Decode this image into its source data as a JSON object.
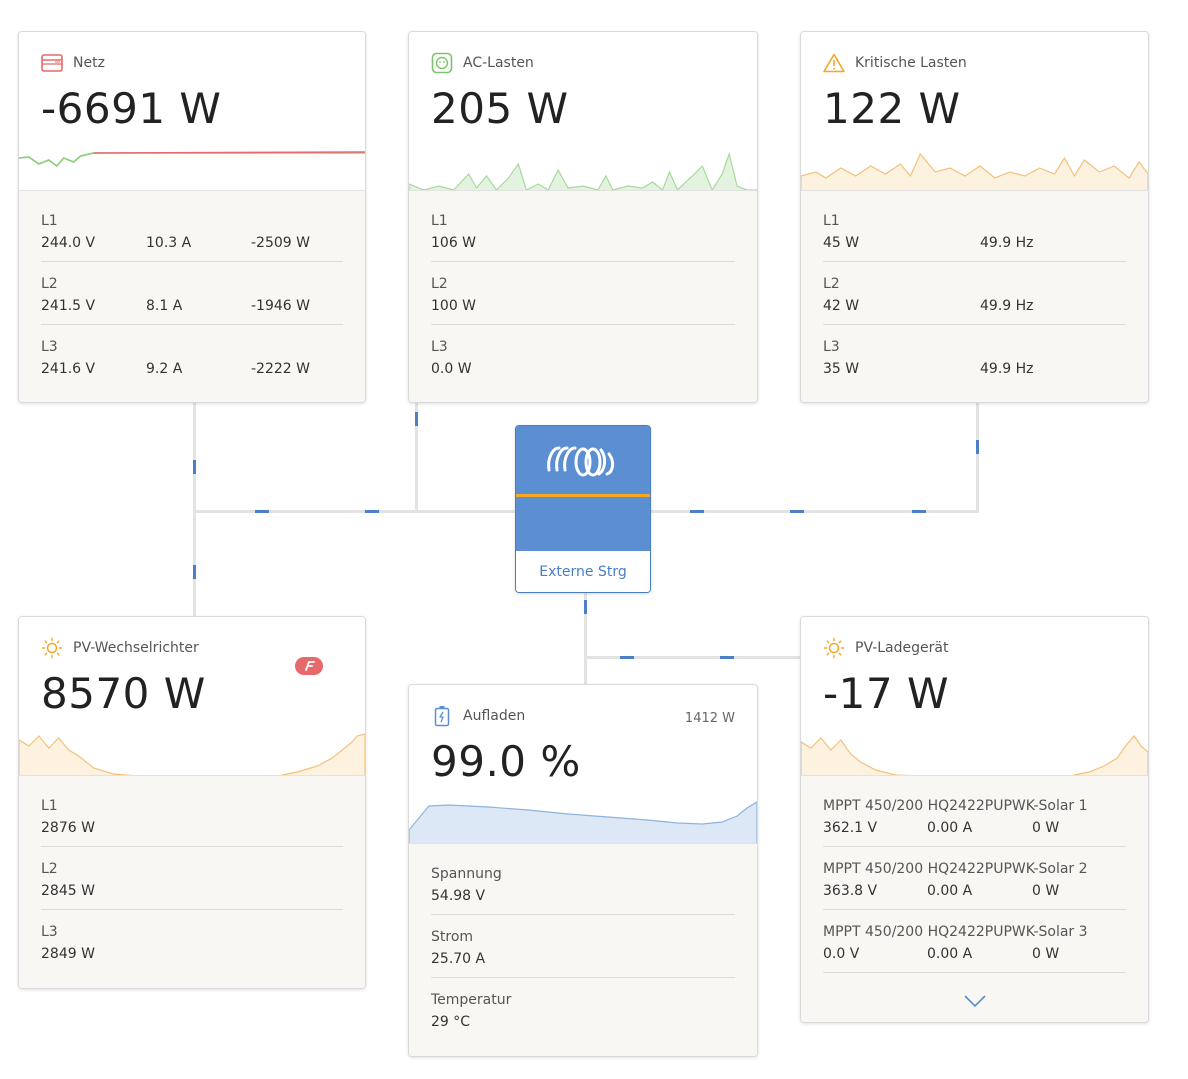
{
  "netz": {
    "title": "Netz",
    "value": "-6691 W",
    "rows": [
      {
        "label": "L1",
        "voltage": "244.0 V",
        "current": "10.3 A",
        "power": "-2509 W"
      },
      {
        "label": "L2",
        "voltage": "241.5 V",
        "current": "8.1 A",
        "power": "-1946 W"
      },
      {
        "label": "L3",
        "voltage": "241.6 V",
        "current": "9.2 A",
        "power": "-2222 W"
      }
    ]
  },
  "ac_lasten": {
    "title": "AC-Lasten",
    "value": "205 W",
    "rows": [
      {
        "label": "L1",
        "power": "106 W"
      },
      {
        "label": "L2",
        "power": "100 W"
      },
      {
        "label": "L3",
        "power": "0.0 W"
      }
    ]
  },
  "kritische_lasten": {
    "title": "Kritische Lasten",
    "value": "122 W",
    "rows": [
      {
        "label": "L1",
        "power": "45 W",
        "frequency": "49.9 Hz"
      },
      {
        "label": "L2",
        "power": "42 W",
        "frequency": "49.9 Hz"
      },
      {
        "label": "L3",
        "power": "35 W",
        "frequency": "49.9 Hz"
      }
    ]
  },
  "inverter": {
    "label": "Externe Strg"
  },
  "pv_wechselrichter": {
    "title": "PV-Wechselrichter",
    "value": "8570 W",
    "rows": [
      {
        "label": "L1",
        "power": "2876 W"
      },
      {
        "label": "L2",
        "power": "2845 W"
      },
      {
        "label": "L3",
        "power": "2849 W"
      }
    ]
  },
  "batterie": {
    "title": "Aufladen",
    "power": "1412 W",
    "value": "99.0 %",
    "rows": [
      {
        "label": "Spannung",
        "value": "54.98 V"
      },
      {
        "label": "Strom",
        "value": "25.70 A"
      },
      {
        "label": "Temperatur",
        "value": "29 °C"
      }
    ]
  },
  "pv_ladegeraet": {
    "title": "PV-Ladegerät",
    "value": "-17 W",
    "rows": [
      {
        "label": "MPPT 450/200 HQ2422PUPWK-Solar 1",
        "voltage": "362.1 V",
        "current": "0.00 A",
        "power": "0 W"
      },
      {
        "label": "MPPT 450/200 HQ2422PUPWK-Solar 2",
        "voltage": "363.8 V",
        "current": "0.00 A",
        "power": "0 W"
      },
      {
        "label": "MPPT 450/200 HQ2422PUPWK-Solar 3",
        "voltage": "0.0 V",
        "current": "0.00 A",
        "power": "0 W"
      }
    ]
  },
  "colors": {
    "grid_red": "#e8696b",
    "grid_green": "#8fce7e",
    "ac_green": "#a7d99b",
    "warning_orange": "#f5a623",
    "solar_orange": "#f3c07a",
    "battery_blue": "#5b8fd1",
    "flow_blue": "#4d7fc4"
  },
  "icons": {
    "netz": "grid-icon",
    "ac_lasten": "outlet-icon",
    "kritische_lasten": "warning-icon",
    "pv_wechselrichter": "sun-icon",
    "batterie": "battery-icon",
    "pv_ladegeraet": "sun-icon",
    "badge": "fronius-badge-icon",
    "expand": "chevron-down-icon"
  }
}
